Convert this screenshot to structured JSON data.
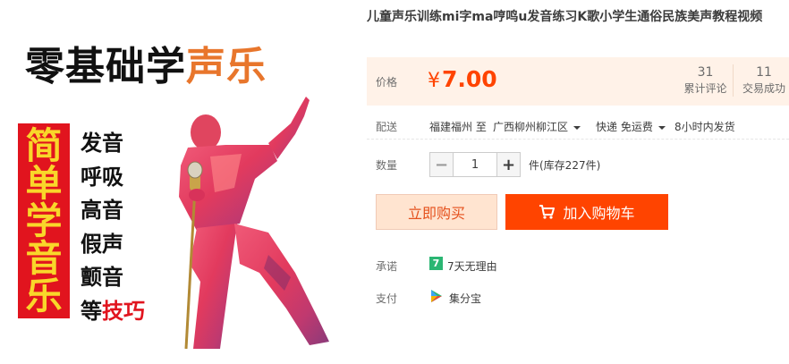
{
  "banner": {
    "headline_dark": "零基础学",
    "headline_orange": "声乐",
    "vertical_text": "简单学音乐",
    "topics": [
      "发音",
      "呼吸",
      "高音",
      "假声",
      "颤音"
    ],
    "last_topic_prefix": "等",
    "last_topic_highlight": "技巧"
  },
  "product": {
    "title": "儿童声乐训练mi字ma哼鸣u发音练习K歌小学生通俗民族美声教程视频"
  },
  "price": {
    "label": "价格",
    "currency": "¥",
    "value": "7.00",
    "reviews_count": "31",
    "reviews_label": "累计评论",
    "trades_count": "11",
    "trades_label": "交易成功"
  },
  "shipping": {
    "label": "配送",
    "from": "福建福州 至",
    "to": "广西柳州柳江区",
    "method": "快递 免运费",
    "time": "8小时内发货"
  },
  "quantity": {
    "label": "数量",
    "minus": "−",
    "value": "1",
    "plus": "+",
    "stock": "件(库存227件)"
  },
  "actions": {
    "buy_now": "立即购买",
    "add_to_cart": "加入购物车"
  },
  "promise": {
    "label": "承诺",
    "badge": "7",
    "text": "7天无理由"
  },
  "payment": {
    "label": "支付",
    "text": "集分宝"
  },
  "colors": {
    "accent": "#ff4400",
    "price": "#ff4400",
    "price_bg": "#fff2e8",
    "buy_now_bg": "#ffe4d0",
    "banner_red": "#e1141e",
    "banner_yellow": "#f9d72a",
    "headline_orange": "#e8762c",
    "promise_green": "#2bb673"
  }
}
